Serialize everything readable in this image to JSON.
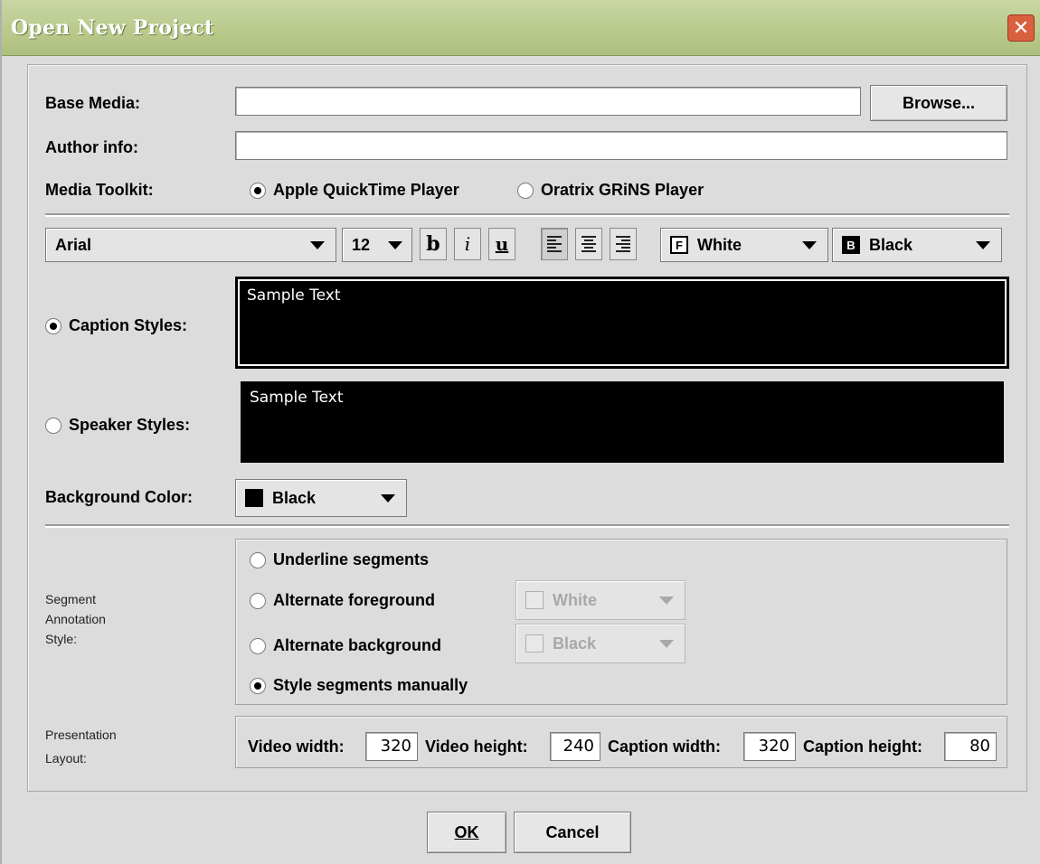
{
  "window": {
    "title": "Open New Project",
    "close_glyph": "✕"
  },
  "form": {
    "base_media_label": "Base Media:",
    "base_media_value": "",
    "browse_label": "Browse...",
    "author_info_label": "Author info:",
    "author_info_value": "",
    "media_toolkit_label": "Media Toolkit:",
    "toolkit_options": [
      {
        "label": "Apple QuickTime Player",
        "selected": true
      },
      {
        "label": "Oratrix GRiNS Player",
        "selected": false
      }
    ]
  },
  "toolbar": {
    "font": "Arial",
    "size": "12",
    "bold_glyph": "b",
    "italic_glyph": "i",
    "underline_glyph": "u",
    "foreground_letter": "F",
    "foreground_color": "White",
    "background_letter": "B",
    "background_color": "Black",
    "selected_alignment": "left"
  },
  "styles": {
    "caption_label": "Caption Styles:",
    "caption_selected": true,
    "caption_sample": "Sample Text",
    "speaker_label": "Speaker Styles:",
    "speaker_selected": false,
    "speaker_sample": "Sample Text",
    "background_color_label": "Background Color:",
    "background_color_value": "Black"
  },
  "segment": {
    "label_line1": "Segment",
    "label_line2": "Annotation",
    "label_line3": "Style:",
    "options": [
      {
        "label": "Underline segments",
        "selected": false
      },
      {
        "label": "Alternate foreground",
        "selected": false
      },
      {
        "label": "Alternate background",
        "selected": false
      },
      {
        "label": "Style segments manually",
        "selected": true
      }
    ],
    "alt_foreground_value": "White",
    "alt_background_value": "Black"
  },
  "layout": {
    "label_line1": "Presentation",
    "label_line2": "Layout:",
    "video_width_label": "Video width:",
    "video_width": "320",
    "video_height_label": "Video height:",
    "video_height": "240",
    "caption_width_label": "Caption width:",
    "caption_width": "320",
    "caption_height_label": "Caption height:",
    "caption_height": "80"
  },
  "buttons": {
    "ok": "OK",
    "cancel": "Cancel"
  },
  "colors": {
    "titlebar": "#b8c98a",
    "dialog_bg": "#dcdcdc",
    "preview_bg": "#000000",
    "preview_text": "#ffffff",
    "close_button": "#d9603e"
  }
}
